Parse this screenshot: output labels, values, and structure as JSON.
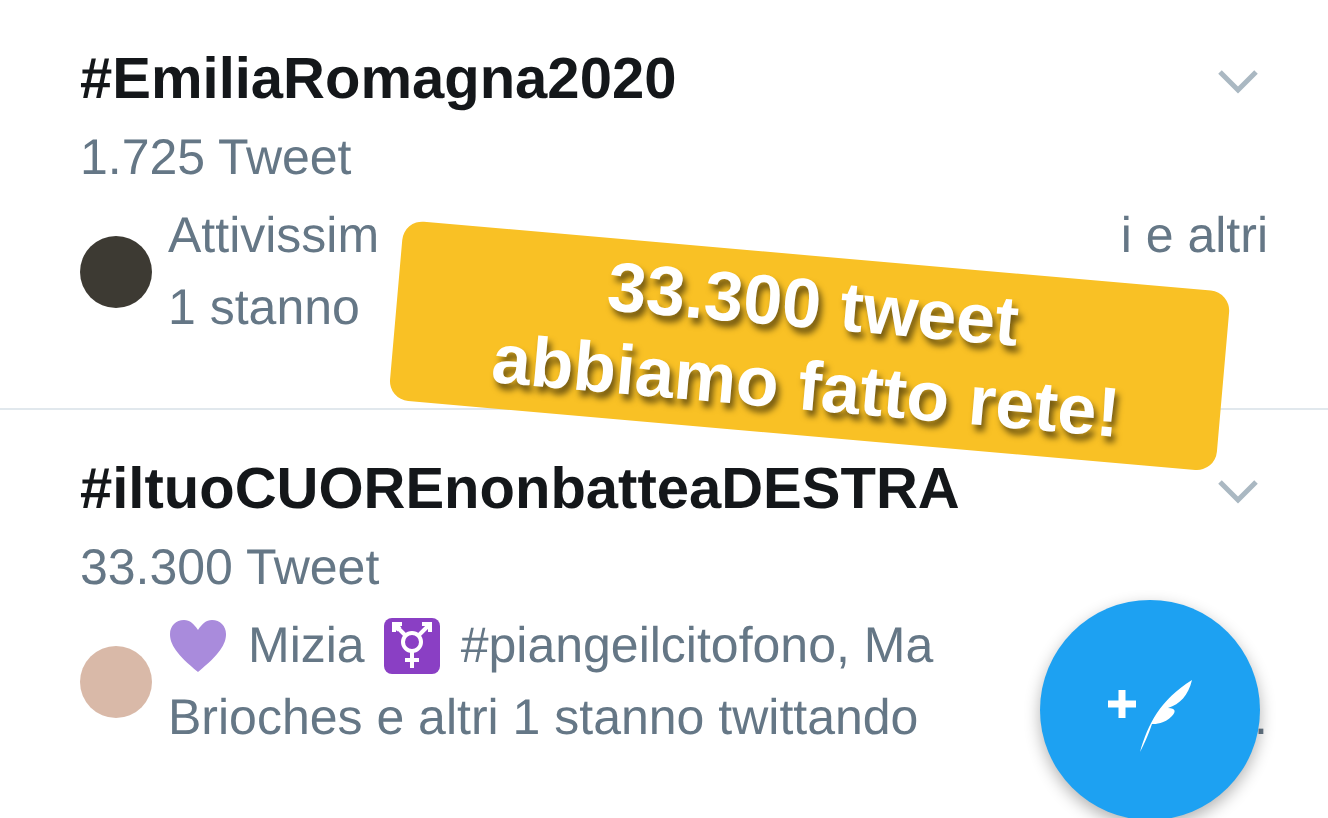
{
  "trends": [
    {
      "title": "#EmiliaRomagna2020",
      "count": "1.725 Tweet",
      "summary_lines": [
        [
          "Attivissim",
          "i e altri"
        ],
        [
          "1 stanno"
        ]
      ]
    },
    {
      "title": "#iltuoCUOREnonbatteaDESTRA",
      "count": "33.300 Tweet",
      "summary_lines": [
        [
          "Mizia",
          "#piangeilcitofono, Ma"
        ],
        [
          "Brioches e altri 1 stanno twittando",
          "."
        ]
      ]
    }
  ],
  "sticker": {
    "lines": [
      "33.300 tweet",
      "abbiamo fatto rete!"
    ]
  }
}
